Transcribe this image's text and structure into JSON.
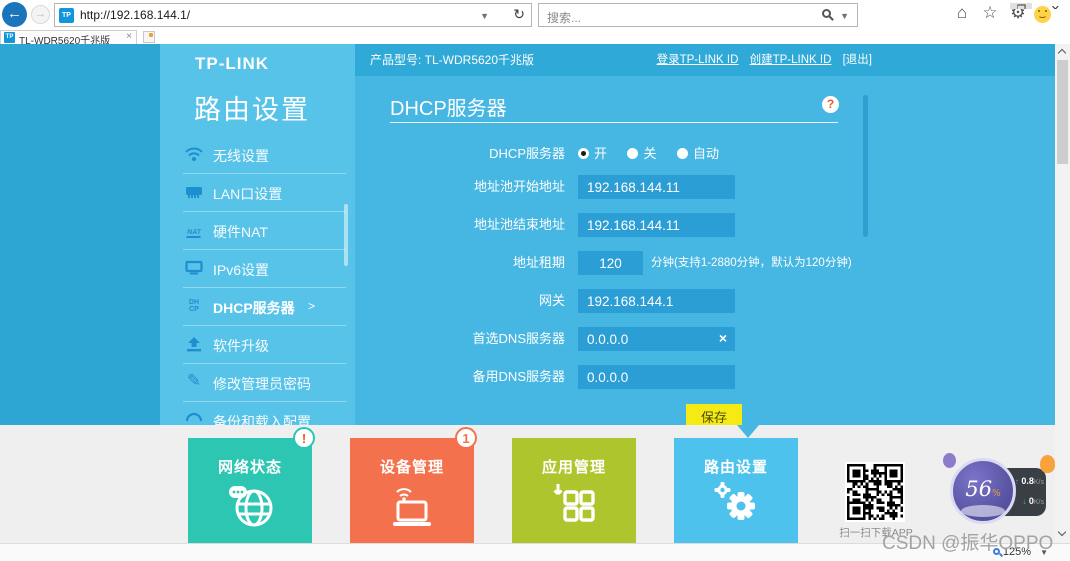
{
  "browser": {
    "back": "←",
    "forward": "→",
    "url": "http://192.168.144.1/",
    "url_dropdown": "▼",
    "refresh": "↻",
    "search_placeholder": "搜索...",
    "search_dropdown": "▼",
    "home": "⌂",
    "star": "☆",
    "gear": "⚙",
    "tab_title": "TL-WDR5620千兆版",
    "tab_close": "×",
    "favicon_text": "TP",
    "win_max": "❐",
    "win_close": "✕",
    "zoom_level": "125%",
    "zoom_dropdown": "▼"
  },
  "sidebar": {
    "logo": "TP-LINK",
    "title": "路由设置",
    "active_arrow": ">",
    "items": [
      {
        "label": "无线设置",
        "icon": "wifi-icon"
      },
      {
        "label": "LAN口设置",
        "icon": "lan-port-icon"
      },
      {
        "label": "硬件NAT",
        "icon": "nat-icon",
        "icon_text": "NAT"
      },
      {
        "label": "IPv6设置",
        "icon": "monitor-icon"
      },
      {
        "label": "DHCP服务器",
        "icon": "dhcp-icon",
        "icon_text_1": "DH",
        "icon_text_2": "CP",
        "active": true
      },
      {
        "label": "软件升级",
        "icon": "upgrade-icon"
      },
      {
        "label": "修改管理员密码",
        "icon": "pencil-icon",
        "glyph": "✎"
      },
      {
        "label": "备份和载入配置",
        "icon": "backup-icon"
      }
    ]
  },
  "header": {
    "product": "产品型号: TL-WDR5620千兆版",
    "login_link": "登录TP-LINK ID",
    "create_link": "创建TP-LINK ID",
    "logout_link": "[退出]"
  },
  "main": {
    "title": "DHCP服务器",
    "help": "?",
    "form": {
      "dhcp_label": "DHCP服务器",
      "radios": [
        {
          "label": "开",
          "selected": true
        },
        {
          "label": "关",
          "selected": false
        },
        {
          "label": "自动",
          "selected": false
        }
      ],
      "pool_start": {
        "label": "地址池开始地址",
        "value": "192.168.144.11"
      },
      "pool_end": {
        "label": "地址池结束地址",
        "value": "192.168.144.11"
      },
      "lease": {
        "label": "地址租期",
        "value": "120",
        "hint": "分钟(支持1-2880分钟，默认为120分钟)"
      },
      "gateway": {
        "label": "网关",
        "value": "192.168.144.1"
      },
      "dns_primary": {
        "label": "首选DNS服务器",
        "value": "0.0.0.0",
        "clear": "×"
      },
      "dns_secondary": {
        "label": "备用DNS服务器",
        "value": "0.0.0.0"
      },
      "save_label": "保存"
    }
  },
  "footer": {
    "tabs": [
      {
        "label": "网络状态",
        "badge": "!",
        "color": "#2cc6b2",
        "icon": "globe-chat-icon"
      },
      {
        "label": "设备管理",
        "badge": "1",
        "color": "#f4714e",
        "icon": "laptop-wifi-icon"
      },
      {
        "label": "应用管理",
        "color": "#aec52d",
        "icon": "apps-grid-icon"
      },
      {
        "label": "路由设置",
        "color": "#4dc2ec",
        "icon": "gears-icon",
        "active": true
      }
    ],
    "qr_caption": "扫一扫下载APP",
    "speed_widget": {
      "percent": "56",
      "percent_sign": "%",
      "up_value": "0.8",
      "down_value": "0",
      "unit": "K/s",
      "up_arrow": "↑",
      "down_arrow": "↓"
    },
    "watermark": "CSDN @振华OPPO"
  },
  "colors": {
    "content_blue": "#46b6e2",
    "sidebar_blue": "#58c3e9",
    "topbar_blue": "#2fa9d7",
    "input_blue": "#2b9ed6",
    "save_yellow": "#f6ea15",
    "tile_teal": "#2cc6b2",
    "tile_orange": "#f4714e",
    "tile_green": "#aec52d",
    "tile_blue": "#4dc2ec",
    "badge_alert": "#f05a28"
  }
}
